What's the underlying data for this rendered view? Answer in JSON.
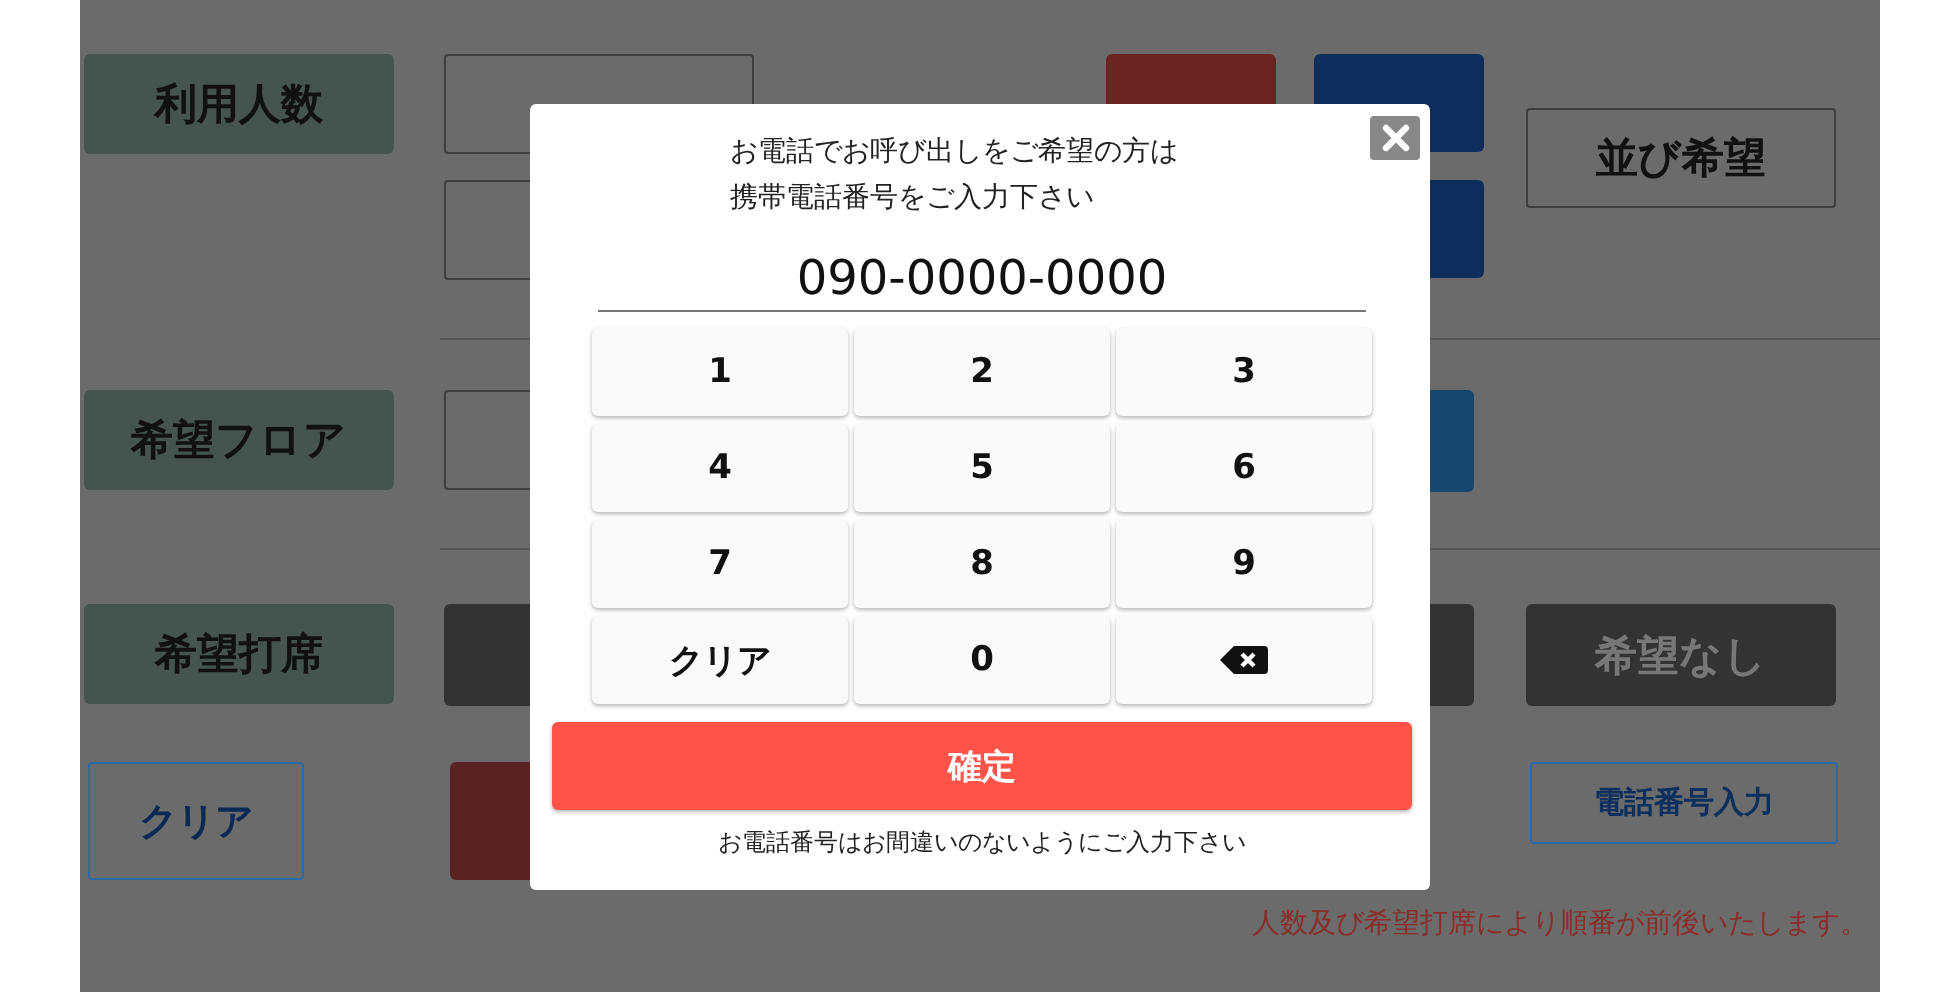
{
  "background": {
    "sections": [
      {
        "label": "利用人数"
      },
      {
        "label": "希望フロア"
      },
      {
        "label": "希望打席"
      }
    ],
    "queue_button": "並び希望",
    "no_preference_button": "希望なし",
    "clear_button": "クリア",
    "phone_button": "電話番号入力",
    "notice": "人数及び希望打席により順番が前後いたします。"
  },
  "dialog": {
    "message_lines": [
      "お電話でお呼び出しをご希望の方は",
      "携帯電話番号をご入力下さい"
    ],
    "phone_value": "090-0000-0000",
    "keys": [
      {
        "kind": "digit",
        "label": "1"
      },
      {
        "kind": "digit",
        "label": "2"
      },
      {
        "kind": "digit",
        "label": "3"
      },
      {
        "kind": "digit",
        "label": "4"
      },
      {
        "kind": "digit",
        "label": "5"
      },
      {
        "kind": "digit",
        "label": "6"
      },
      {
        "kind": "digit",
        "label": "7"
      },
      {
        "kind": "digit",
        "label": "8"
      },
      {
        "kind": "digit",
        "label": "9"
      },
      {
        "kind": "clear",
        "label": "クリア"
      },
      {
        "kind": "digit",
        "label": "0"
      },
      {
        "kind": "backspace"
      }
    ],
    "confirm_button": "確定",
    "note": "お電話番号はお間違いのないようにご入力下さい"
  }
}
